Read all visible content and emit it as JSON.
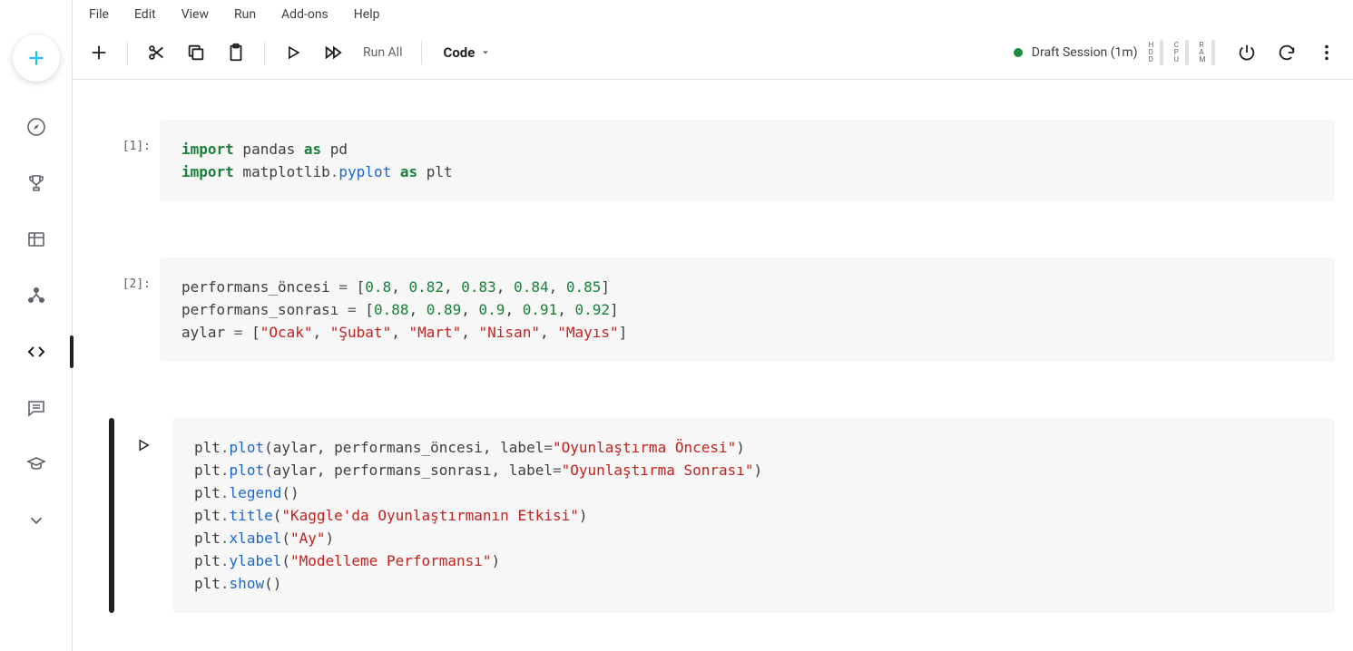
{
  "menubar": {
    "file": "File",
    "edit": "Edit",
    "view": "View",
    "run": "Run",
    "addons": "Add-ons",
    "help": "Help"
  },
  "toolbar": {
    "run_all": "Run All",
    "celltype": "Code",
    "status": "Draft Session (1m)",
    "meters": {
      "hdd": "H\nD\nD",
      "cpu": "C\nP\nU",
      "ram": "R\nA\nM"
    }
  },
  "cells": {
    "c1": {
      "prompt": "[1]:",
      "code_html": "<span class='tok-kw'>import</span> pandas <span class='tok-kw'>as</span> pd\n<span class='tok-kw'>import</span> matplotlib<span class='tok-op'>.</span><span class='tok-func'>pyplot</span> <span class='tok-kw'>as</span> plt"
    },
    "c2": {
      "prompt": "[2]:",
      "code_html": "performans_öncesi <span class='tok-op'>=</span> [<span class='tok-num'>0.8</span>, <span class='tok-num'>0.82</span>, <span class='tok-num'>0.83</span>, <span class='tok-num'>0.84</span>, <span class='tok-num'>0.85</span>]\nperformans_sonrası <span class='tok-op'>=</span> [<span class='tok-num'>0.88</span>, <span class='tok-num'>0.89</span>, <span class='tok-num'>0.9</span>, <span class='tok-num'>0.91</span>, <span class='tok-num'>0.92</span>]\naylar <span class='tok-op'>=</span> [<span class='tok-str'>\"Ocak\"</span>, <span class='tok-str'>\"Şubat\"</span>, <span class='tok-str'>\"Mart\"</span>, <span class='tok-str'>\"Nisan\"</span>, <span class='tok-str'>\"Mayıs\"</span>]"
    },
    "c3": {
      "prompt": "",
      "code_html": "plt<span class='tok-op'>.</span><span class='tok-func'>plot</span>(aylar, performans_öncesi, label<span class='tok-op'>=</span><span class='tok-str'>\"Oyunlaştırma Öncesi\"</span>)\nplt<span class='tok-op'>.</span><span class='tok-func'>plot</span>(aylar, performans_sonrası, label<span class='tok-op'>=</span><span class='tok-str'>\"Oyunlaştırma Sonrası\"</span>)\nplt<span class='tok-op'>.</span><span class='tok-func'>legend</span>()\nplt<span class='tok-op'>.</span><span class='tok-func'>title</span>(<span class='tok-str'>\"Kaggle'da Oyunlaştırmanın Etkisi\"</span>)\nplt<span class='tok-op'>.</span><span class='tok-func'>xlabel</span>(<span class='tok-str'>\"Ay\"</span>)\nplt<span class='tok-op'>.</span><span class='tok-func'>ylabel</span>(<span class='tok-str'>\"Modelleme Performansı\"</span>)\nplt<span class='tok-op'>.</span><span class='tok-func'>show</span>()"
    }
  }
}
